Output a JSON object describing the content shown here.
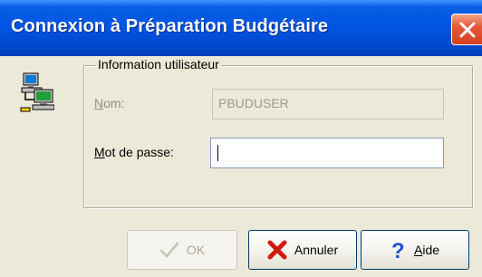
{
  "window": {
    "title": "Connexion à Préparation Budgétaire"
  },
  "group": {
    "legend": "Information utilisateur"
  },
  "fields": {
    "nom_label_accel": "N",
    "nom_label_rest": "om:",
    "nom_value": "PBUDUSER",
    "password_label_accel": "M",
    "password_label_rest": "ot de passe:",
    "password_value": ""
  },
  "buttons": {
    "ok_label": "OK",
    "cancel_label": "Annuler",
    "help_label_accel": "A",
    "help_label_rest": "ide"
  },
  "icons": {
    "window_icon": "computer-network-icon",
    "close": "close-icon",
    "ok": "checkmark-icon",
    "cancel": "red-x-icon",
    "help": "question-mark-icon"
  },
  "colors": {
    "titlebar": "#0055e5",
    "close_button": "#e5593a",
    "dialog_background": "#ece9d8",
    "cancel_icon": "#d11b0f",
    "help_icon": "#1a4fd0"
  }
}
